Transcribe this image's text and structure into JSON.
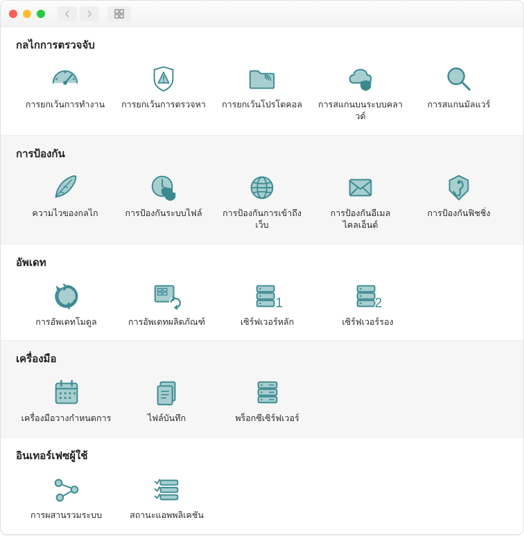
{
  "colors": {
    "iconFill": "#a8ced0",
    "iconStroke": "#3a8a91"
  },
  "sections": [
    {
      "alt": false,
      "title": "กลไกการตรวจจับ",
      "items": [
        {
          "icon": "performance-icon",
          "label": "การยกเว้นการทำงาน"
        },
        {
          "icon": "shield-warning-icon",
          "label": "การยกเว้นการตรวจหา"
        },
        {
          "icon": "folder-protocol-icon",
          "label": "การยกเว้นโปรโตคอล"
        },
        {
          "icon": "cloud-shield-icon",
          "label": "การสแกนบนระบบคลาวด์"
        },
        {
          "icon": "magnifier-icon",
          "label": "การสแกนมัลแวร์"
        }
      ]
    },
    {
      "alt": true,
      "title": "การป้องกัน",
      "items": [
        {
          "icon": "feather-icon",
          "label": "ความไวของกลไก"
        },
        {
          "icon": "clock-shield-icon",
          "label": "การป้องกันระบบไฟล์"
        },
        {
          "icon": "globe-icon",
          "label": "การป้องกันการเข้าถึงเว็บ"
        },
        {
          "icon": "mail-icon",
          "label": "การป้องกันอีเมลไคลเอ็นต์"
        },
        {
          "icon": "phishing-icon",
          "label": "การป้องกันฟิชชิ่ง"
        }
      ]
    },
    {
      "alt": false,
      "title": "อัพเดท",
      "items": [
        {
          "icon": "refresh-icon",
          "label": "การอัพเดทโมดูล"
        },
        {
          "icon": "product-update-icon",
          "label": "การอัพเดทผลิตภัณฑ์"
        },
        {
          "icon": "server1-icon",
          "label": "เซิร์ฟเวอร์หลัก"
        },
        {
          "icon": "server2-icon",
          "label": "เซิร์ฟเวอร์รอง"
        }
      ]
    },
    {
      "alt": true,
      "title": "เครื่องมือ",
      "items": [
        {
          "icon": "calendar-icon",
          "label": "เครื่องมือวางกำหนดการ"
        },
        {
          "icon": "files-icon",
          "label": "ไฟล์บันทึก"
        },
        {
          "icon": "server-icon",
          "label": "พร็อกซีเซิร์ฟเวอร์"
        }
      ]
    },
    {
      "alt": false,
      "title": "อินเทอร์เฟซผู้ใช้",
      "items": [
        {
          "icon": "integration-icon",
          "label": "การผสานรวมระบบ"
        },
        {
          "icon": "status-icon",
          "label": "สถานะแอพพลิเคชัน"
        }
      ]
    }
  ]
}
